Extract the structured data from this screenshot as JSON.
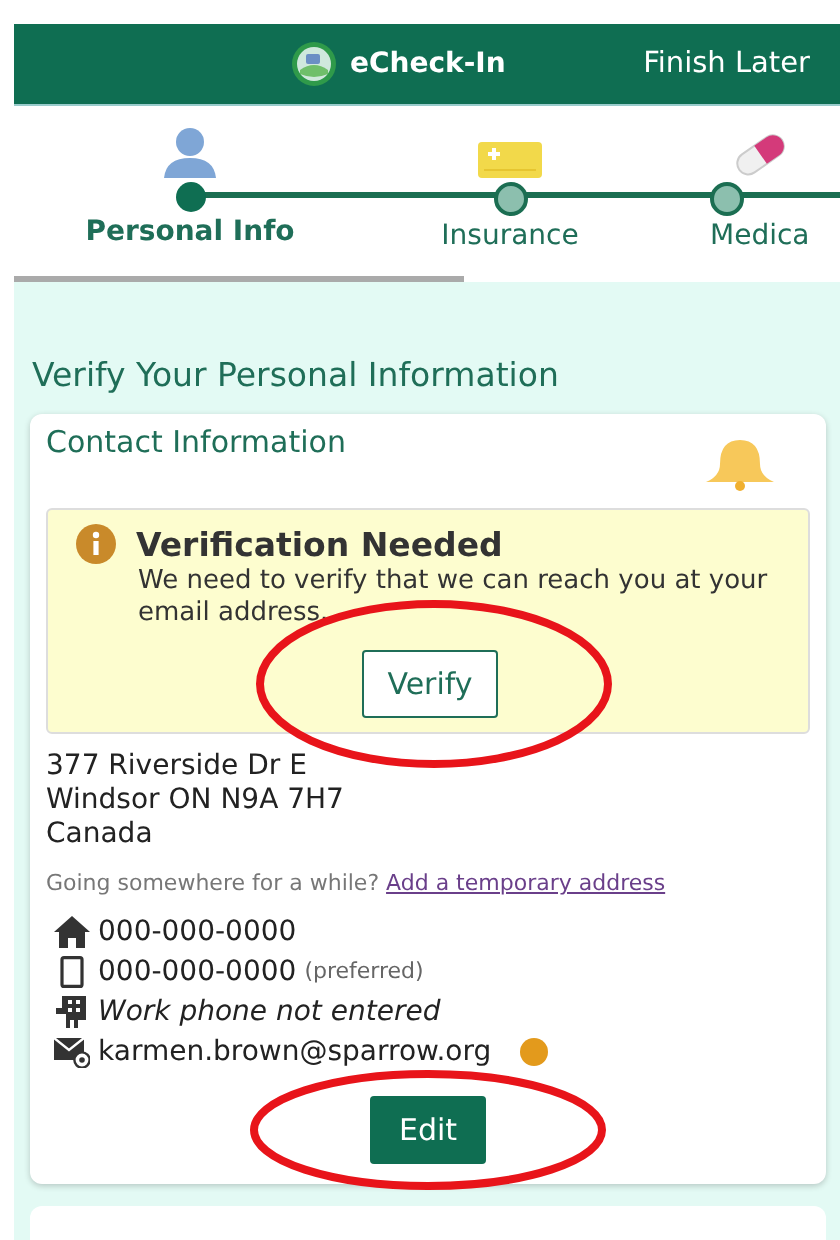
{
  "header": {
    "title": "eCheck-In",
    "action": "Finish Later"
  },
  "steps": [
    {
      "label": "Personal Info",
      "kind": "person",
      "selected": true
    },
    {
      "label": "Insurance",
      "kind": "card",
      "selected": false
    },
    {
      "label": "Medica",
      "kind": "pill",
      "selected": false
    }
  ],
  "page_title": "Verify Your Personal Information",
  "contact": {
    "title": "Contact Information",
    "alert": {
      "title": "Verification Needed",
      "message": "We need to verify that we can reach you at your email address.",
      "button": {
        "label": "Verify",
        "circled": true
      }
    },
    "address": [
      "377 Riverside Dr E",
      "Windsor ON N9A 7H7",
      "Canada"
    ],
    "temp_prompt": "Going somewhere for a while?",
    "temp_link": "Add a temporary address",
    "rows": [
      {
        "kind": "home",
        "value": "000-000-0000",
        "missing": false,
        "warning": false
      },
      {
        "kind": "mobile",
        "value": "000-000-0000",
        "note": "(preferred)",
        "missing": false,
        "warning": false
      },
      {
        "kind": "work",
        "value": "Work phone not entered",
        "missing": true,
        "warning": false
      },
      {
        "kind": "email",
        "value": "karmen.brown@sparrow.org",
        "missing": false,
        "warning": true
      }
    ],
    "edit_button": {
      "label": "Edit",
      "circled": true
    }
  }
}
